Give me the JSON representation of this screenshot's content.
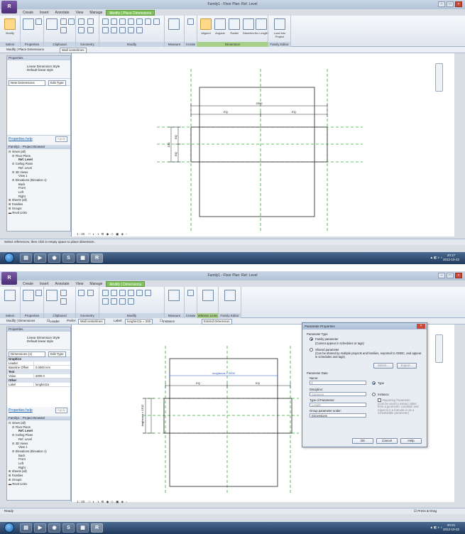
{
  "screen1": {
    "title": "Family1 - Floor Plan: Ref. Level",
    "tabs": [
      "Create",
      "Insert",
      "Annotate",
      "View",
      "Manage",
      "Modify | Place Dimensions"
    ],
    "ribbon_groups": [
      "Select",
      "Properties",
      "Clipboard",
      "Geometry",
      "Modify",
      "Measure",
      "Create",
      "Dimension",
      "Family Editor"
    ],
    "ribbon_buttons": [
      "Modify",
      "Aligned",
      "Angular",
      "Radial",
      "Diameter",
      "Arc Length",
      "Load into Project"
    ],
    "options_label": "Modify | Place Dimensions",
    "options_value": "Wall centerlines",
    "properties_header": "Properties",
    "type_name": "Linear Dimension Style",
    "type_sub": "Default linear style",
    "type_selector": "New Dimensions",
    "edit_type": "Edit Type",
    "properties_help": "Properties help",
    "apply": "Apply",
    "browser_header": "Family1 - Project Browser",
    "tree": [
      "Views (all)",
      "Floor Plans",
      "Ref. Level",
      "Ceiling Plans",
      "Ref. Level",
      "3D Views",
      "View 1",
      "Elevations (Elevation 1)",
      "Back",
      "Front",
      "Left",
      "Right",
      "Sheets (all)",
      "Families",
      "Groups",
      "Revit Links"
    ],
    "dim_top": "2000",
    "dim_eq_left": "EQ",
    "dim_eq_right": "EQ",
    "dim_side_left": "EQ",
    "dim_side_right": "EQ",
    "dim_side_total": "150",
    "scale": "1 : 20",
    "status": "Select references, then click in empty space to place dimension.",
    "clock_time": "20:17",
    "clock_date": "2012-10-22"
  },
  "screen2": {
    "title": "Family1 - Floor Plan: Ref. Level",
    "tabs": [
      "Create",
      "Insert",
      "Annotate",
      "View",
      "Manage",
      "Modify | Dimensions"
    ],
    "ribbon_groups": [
      "Select",
      "Properties",
      "Clipboard",
      "Geometry",
      "Modify",
      "Measure",
      "Create",
      "Witness Lines",
      "Family Editor"
    ],
    "options_label": "Modify | Dimensions",
    "leader_label": "Leader",
    "prefer_label": "Prefer:",
    "prefer_value": "Wall centerlines",
    "label_label": "Label:",
    "label_value": "lunghezza = 200",
    "instance_param": "Instance Parameter",
    "extend_btn": "Extend Dimension",
    "type_name": "Linear Dimension Style",
    "type_sub": "Default linear style",
    "type_selector": "Dimensions (1)",
    "edit_type": "Edit Type",
    "prop_sections": [
      "Graphics",
      "Text",
      "Other"
    ],
    "prop_rows": [
      {
        "k": "Leader",
        "v": ""
      },
      {
        "k": "Baseline Offset",
        "v": "0.0000 mm"
      },
      {
        "k": "Value",
        "v": "2000.0"
      },
      {
        "k": "Label",
        "v": "lunghezza"
      }
    ],
    "properties_help": "Properties help",
    "apply": "Apply",
    "browser_header": "Family1 - Project Browser",
    "dim_top": "lunghezza = 2000",
    "dim_eq_left": "EQ",
    "dim_eq_right": "EQ",
    "dim_side": "larghezza = 1512",
    "scale": "1 : 20",
    "status": "Ready",
    "press_drag": "Press & Drag",
    "clock_time": "20:21",
    "clock_date": "2012-10-22",
    "dialog": {
      "title": "Parameter Properties",
      "param_type": "Parameter Type",
      "family_param": "Family parameter",
      "family_param_note": "(Cannot appear in schedules or tags)",
      "shared_param": "Shared parameter",
      "shared_note": "(Can be shared by multiple projects and families, exported to ODBC, and appear in schedules and tags)",
      "select_btn": "Select...",
      "export_btn": "Export...",
      "param_data": "Parameter Data",
      "name_label": "Name:",
      "name_value": "l",
      "type_radio": "Type",
      "discipline_label": "Discipline:",
      "discipline_value": "Common",
      "instance_radio": "Instance",
      "type_param_label": "Type of Parameter:",
      "type_param_value": "Length",
      "reporting": "Reporting Parameter",
      "reporting_note": "(Can be used to extract value from a geometric condition and report it in a formula or as a schedulable parameter)",
      "group_label": "Group parameter under:",
      "group_value": "Dimensions",
      "ok": "OK",
      "cancel": "Cancel",
      "help": "Help"
    }
  }
}
